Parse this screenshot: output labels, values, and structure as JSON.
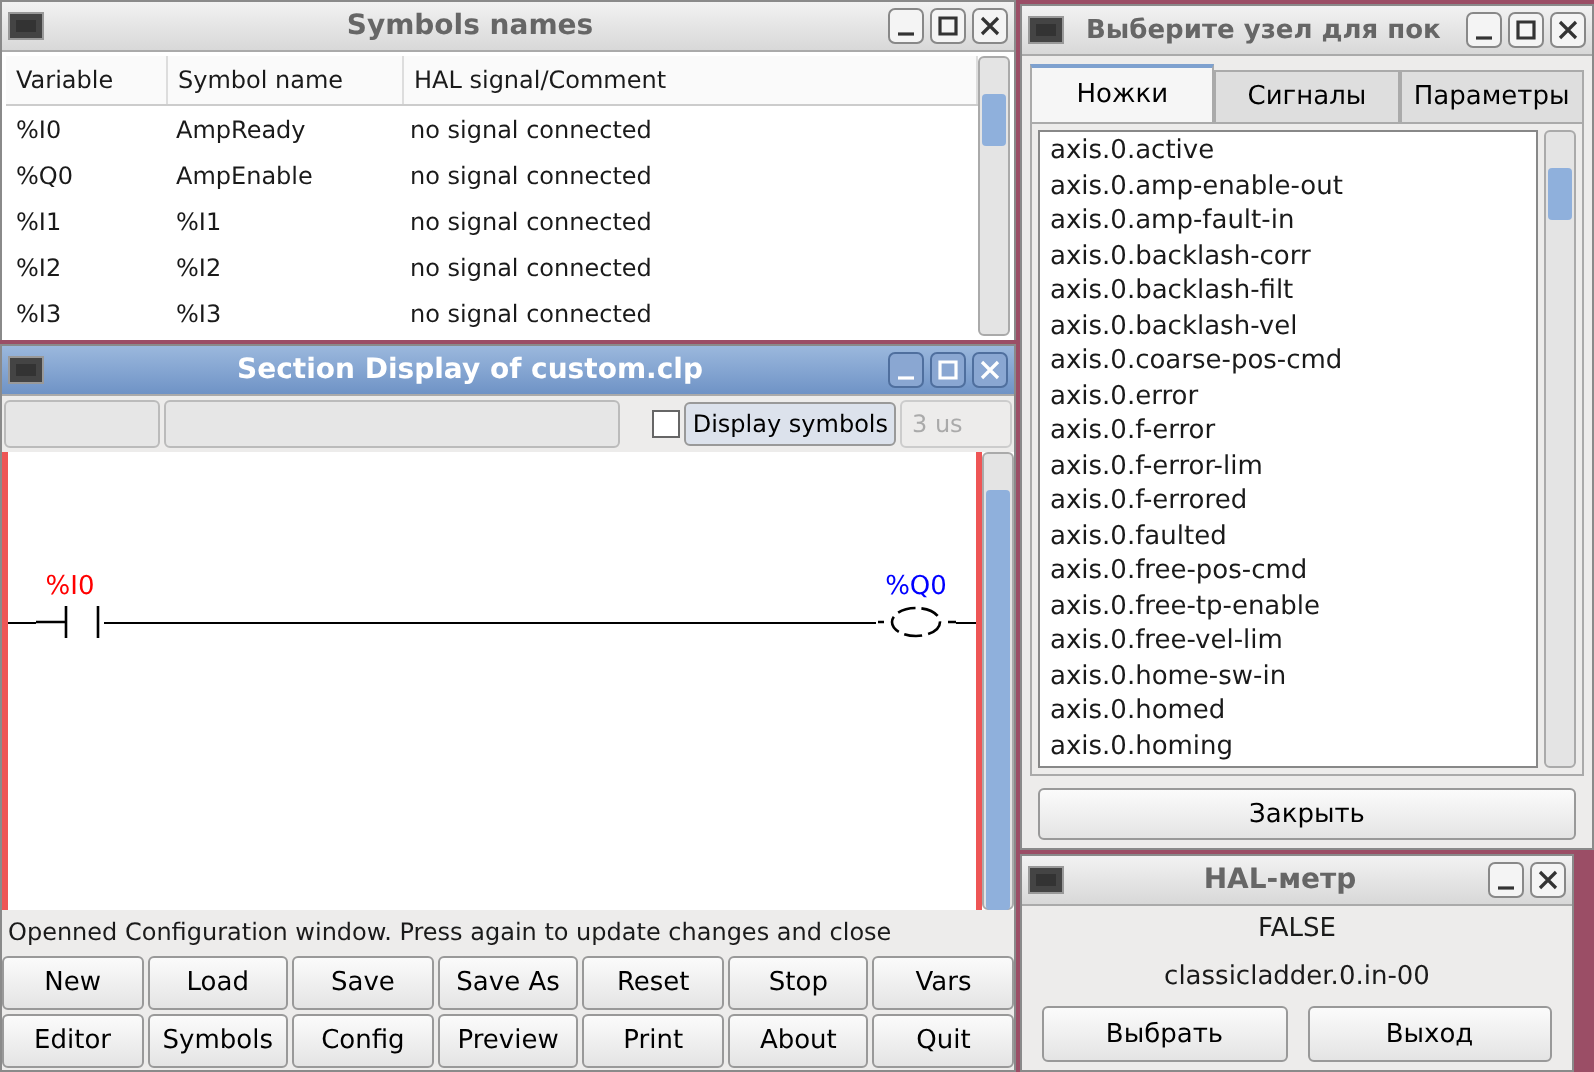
{
  "symbols_window": {
    "title": "Symbols names",
    "active": false,
    "columns": [
      "Variable",
      "Symbol name",
      "HAL signal/Comment"
    ],
    "rows": [
      [
        "%I0",
        "AmpReady",
        "no signal connected"
      ],
      [
        "%Q0",
        "AmpEnable",
        "no signal connected"
      ],
      [
        "%I1",
        "%I1",
        "no signal connected"
      ],
      [
        "%I2",
        "%I2",
        "no signal connected"
      ],
      [
        "%I3",
        "%I3",
        "no signal connected"
      ]
    ]
  },
  "section_window": {
    "title": "Section Display of custom.clp",
    "active": true,
    "display_symbols": {
      "label": "Display symbols",
      "checked": false
    },
    "timing": "3 us",
    "rung": [
      {
        "kind": "contact",
        "label": "%I0"
      },
      {
        "kind": "coil",
        "label": "%Q0"
      }
    ],
    "status": "Openned Configuration window. Press again to update changes and close",
    "buttons": [
      [
        "New",
        "Load",
        "Save",
        "Save As",
        "Reset",
        "Stop",
        "Vars"
      ],
      [
        "Editor",
        "Symbols",
        "Config",
        "Preview",
        "Print",
        "About",
        "Quit"
      ]
    ]
  },
  "select_window": {
    "title": "Выберите узел для пок",
    "active": false,
    "tabs": [
      {
        "label": "Ножки",
        "selected": true
      },
      {
        "label": "Сигналы",
        "selected": false
      },
      {
        "label": "Параметры",
        "selected": false
      }
    ],
    "items": [
      "axis.0.active",
      "axis.0.amp-enable-out",
      "axis.0.amp-fault-in",
      "axis.0.backlash-corr",
      "axis.0.backlash-filt",
      "axis.0.backlash-vel",
      "axis.0.coarse-pos-cmd",
      "axis.0.error",
      "axis.0.f-error",
      "axis.0.f-error-lim",
      "axis.0.f-errored",
      "axis.0.faulted",
      "axis.0.free-pos-cmd",
      "axis.0.free-tp-enable",
      "axis.0.free-vel-lim",
      "axis.0.home-sw-in",
      "axis.0.homed",
      "axis.0.homing"
    ],
    "close_button": "Закрыть"
  },
  "meter_window": {
    "title": "HAL-метр",
    "active": false,
    "value": "FALSE",
    "pin": "classicladder.0.in-00",
    "buttons": [
      "Выбрать",
      "Выход"
    ]
  }
}
